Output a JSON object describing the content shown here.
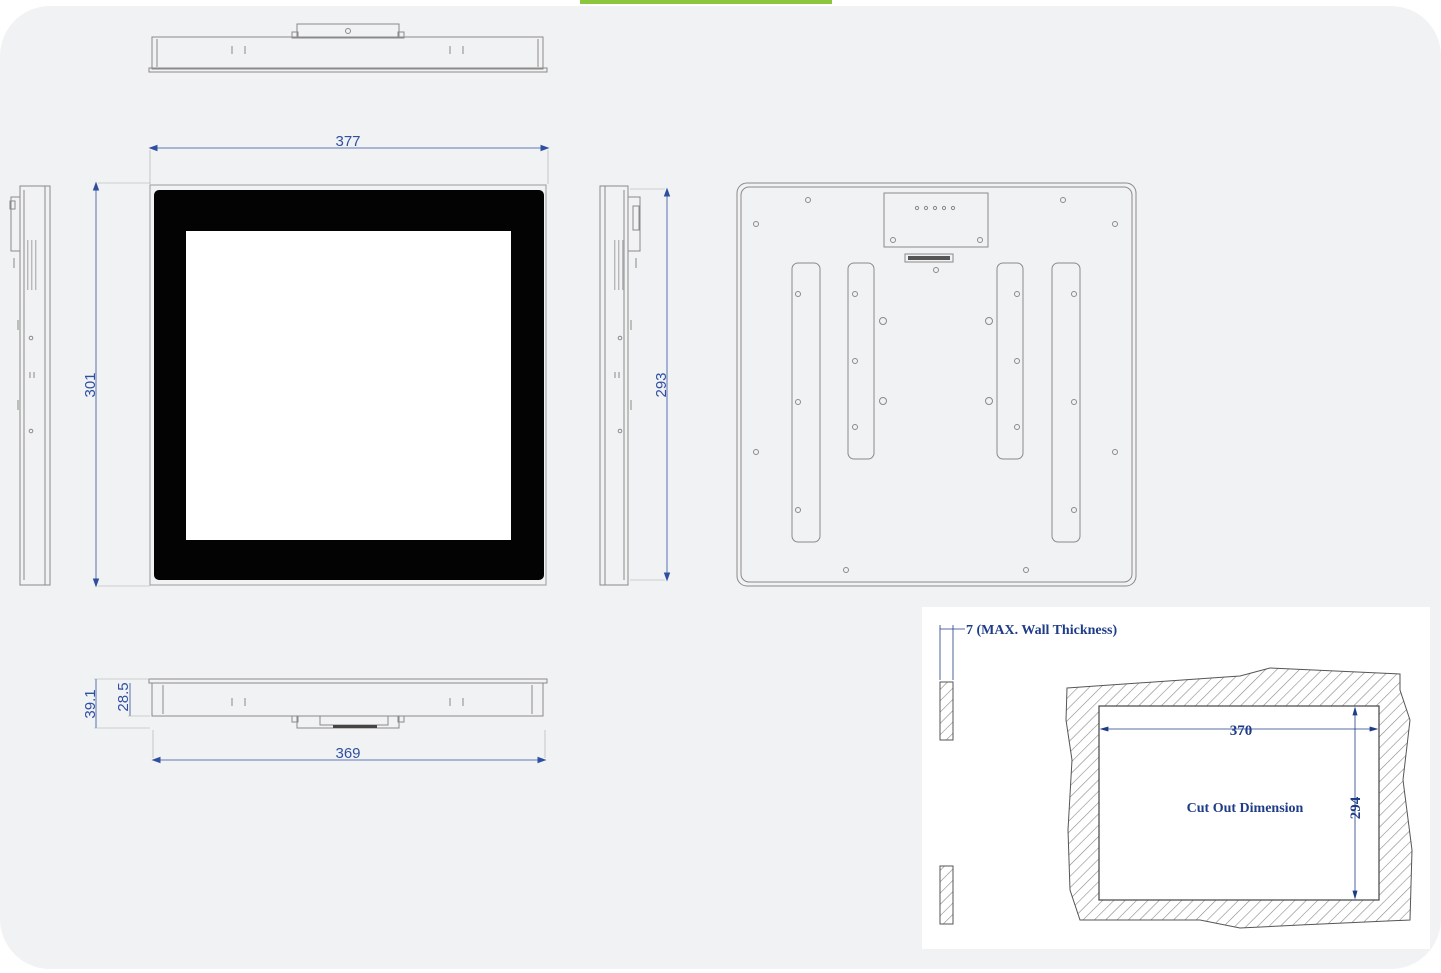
{
  "dimensions": {
    "width_top": "377",
    "height_left": "301",
    "height_right": "293",
    "depth_total": "39.1",
    "depth_body": "28.5",
    "width_bottom": "369"
  },
  "cutout": {
    "wall_note": "7 (MAX. Wall Thickness)",
    "width": "370",
    "height": "294",
    "label": "Cut Out Dimension"
  },
  "colors": {
    "accent_tab": "#8cc63f",
    "panel_bg": "#f1f2f4",
    "dimension_text": "#2f4fa0"
  }
}
